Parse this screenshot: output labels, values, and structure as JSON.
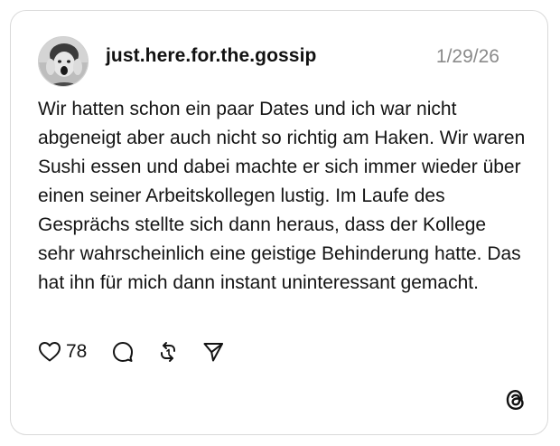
{
  "post": {
    "username": "just.here.for.the.gossip",
    "date": "1/29/26",
    "text": "Wir hatten schon ein paar Dates und ich war nicht abgeneigt aber auch nicht so richtig am Haken. Wir waren Sushi essen und dabei machte er sich immer wieder über einen seiner Arbeitskollegen lustig. Im Laufe des Gesprächs stellte sich dann heraus, dass der Kollege sehr wahrscheinlich eine geistige Behinderung hatte. Das hat ihn für mich dann instant uninteressant gemacht.",
    "likes": "78"
  },
  "icons": {
    "like": "heart-icon",
    "comment": "comment-bubble-icon",
    "repost": "repost-icon",
    "share": "send-icon",
    "brand": "threads-logo-icon"
  },
  "colors": {
    "text": "#141414",
    "muted": "#8a8a8a",
    "border": "#d9d9d9",
    "background": "#ffffff"
  }
}
